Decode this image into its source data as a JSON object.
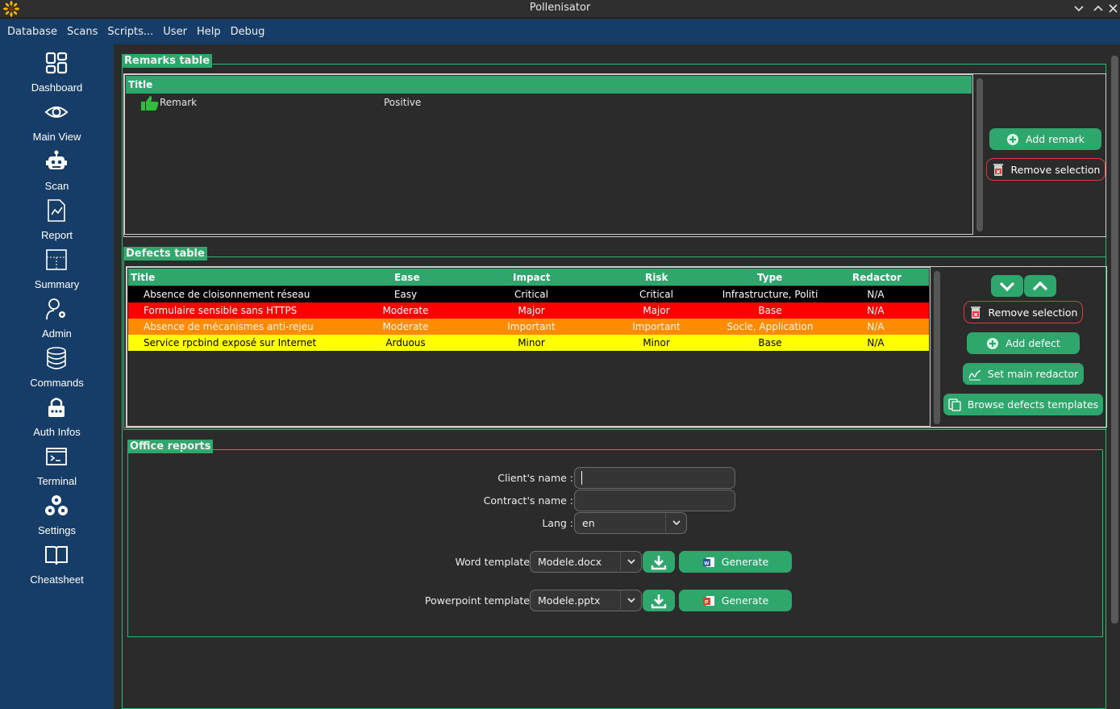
{
  "window": {
    "title": "Pollenisator"
  },
  "menu": [
    "Database",
    "Scans",
    "Scripts...",
    "User",
    "Help",
    "Debug"
  ],
  "sidebar": {
    "items": [
      {
        "label": "Dashboard",
        "icon": "dashboard-icon"
      },
      {
        "label": "Main View",
        "icon": "eye-icon"
      },
      {
        "label": "Scan",
        "icon": "robot-icon"
      },
      {
        "label": "Report",
        "icon": "report-icon"
      },
      {
        "label": "Summary",
        "icon": "summary-icon"
      },
      {
        "label": "Admin",
        "icon": "admin-icon"
      },
      {
        "label": "Commands",
        "icon": "database-icon"
      },
      {
        "label": "Auth Infos",
        "icon": "lock-icon"
      },
      {
        "label": "Terminal",
        "icon": "terminal-icon"
      },
      {
        "label": "Settings",
        "icon": "gears-icon"
      },
      {
        "label": "Cheatsheet",
        "icon": "book-icon"
      }
    ]
  },
  "remarks": {
    "section_title": "Remarks table",
    "header": "Title",
    "rows": [
      {
        "title": "Remark",
        "type": "Positive",
        "icon": "thumbs-up-icon"
      }
    ],
    "add_label": "Add remark",
    "remove_label": "Remove selection"
  },
  "defects": {
    "section_title": "Defects table",
    "columns": [
      "Title",
      "Ease",
      "Impact",
      "Risk",
      "Type",
      "Redactor"
    ],
    "rows": [
      {
        "title": "Absence de cloisonnement réseau",
        "ease": "Easy",
        "impact": "Critical",
        "risk": "Critical",
        "type": "Infrastructure, Politi",
        "redactor": "N/A",
        "bg": "#000000",
        "fg": "#ffffff"
      },
      {
        "title": "Formulaire sensible sans HTTPS",
        "ease": "Moderate",
        "impact": "Major",
        "risk": "Major",
        "type": "Base",
        "redactor": "N/A",
        "bg": "#ff0000",
        "fg": "#ffffff"
      },
      {
        "title": "Absence de mécanismes anti-rejeu",
        "ease": "Moderate",
        "impact": "Important",
        "risk": "Important",
        "type": "Socle, Application",
        "redactor": "N/A",
        "bg": "#ff8c00",
        "fg": "#f5f5f5"
      },
      {
        "title": "Service rpcbind exposé sur Internet",
        "ease": "Arduous",
        "impact": "Minor",
        "risk": "Minor",
        "type": "Base",
        "redactor": "N/A",
        "bg": "#ffff00",
        "fg": "#000000"
      }
    ],
    "remove_label": "Remove selection",
    "add_label": "Add defect",
    "set_redactor_label": "Set main redactor",
    "browse_label": "Browse defects templates"
  },
  "office": {
    "section_title": "Office reports",
    "client_label": "Client's name :",
    "client_value": "",
    "contract_label": "Contract's name :",
    "contract_value": "",
    "lang_label": "Lang :",
    "lang_value": "en",
    "word_label": "Word template",
    "word_value": "Modele.docx",
    "ppt_label": "Powerpoint template",
    "ppt_value": "Modele.pptx",
    "generate_label": "Generate"
  },
  "colors": {
    "accent": "#2ea66c",
    "sidebar": "#163d67",
    "danger": "#e03a3a"
  }
}
